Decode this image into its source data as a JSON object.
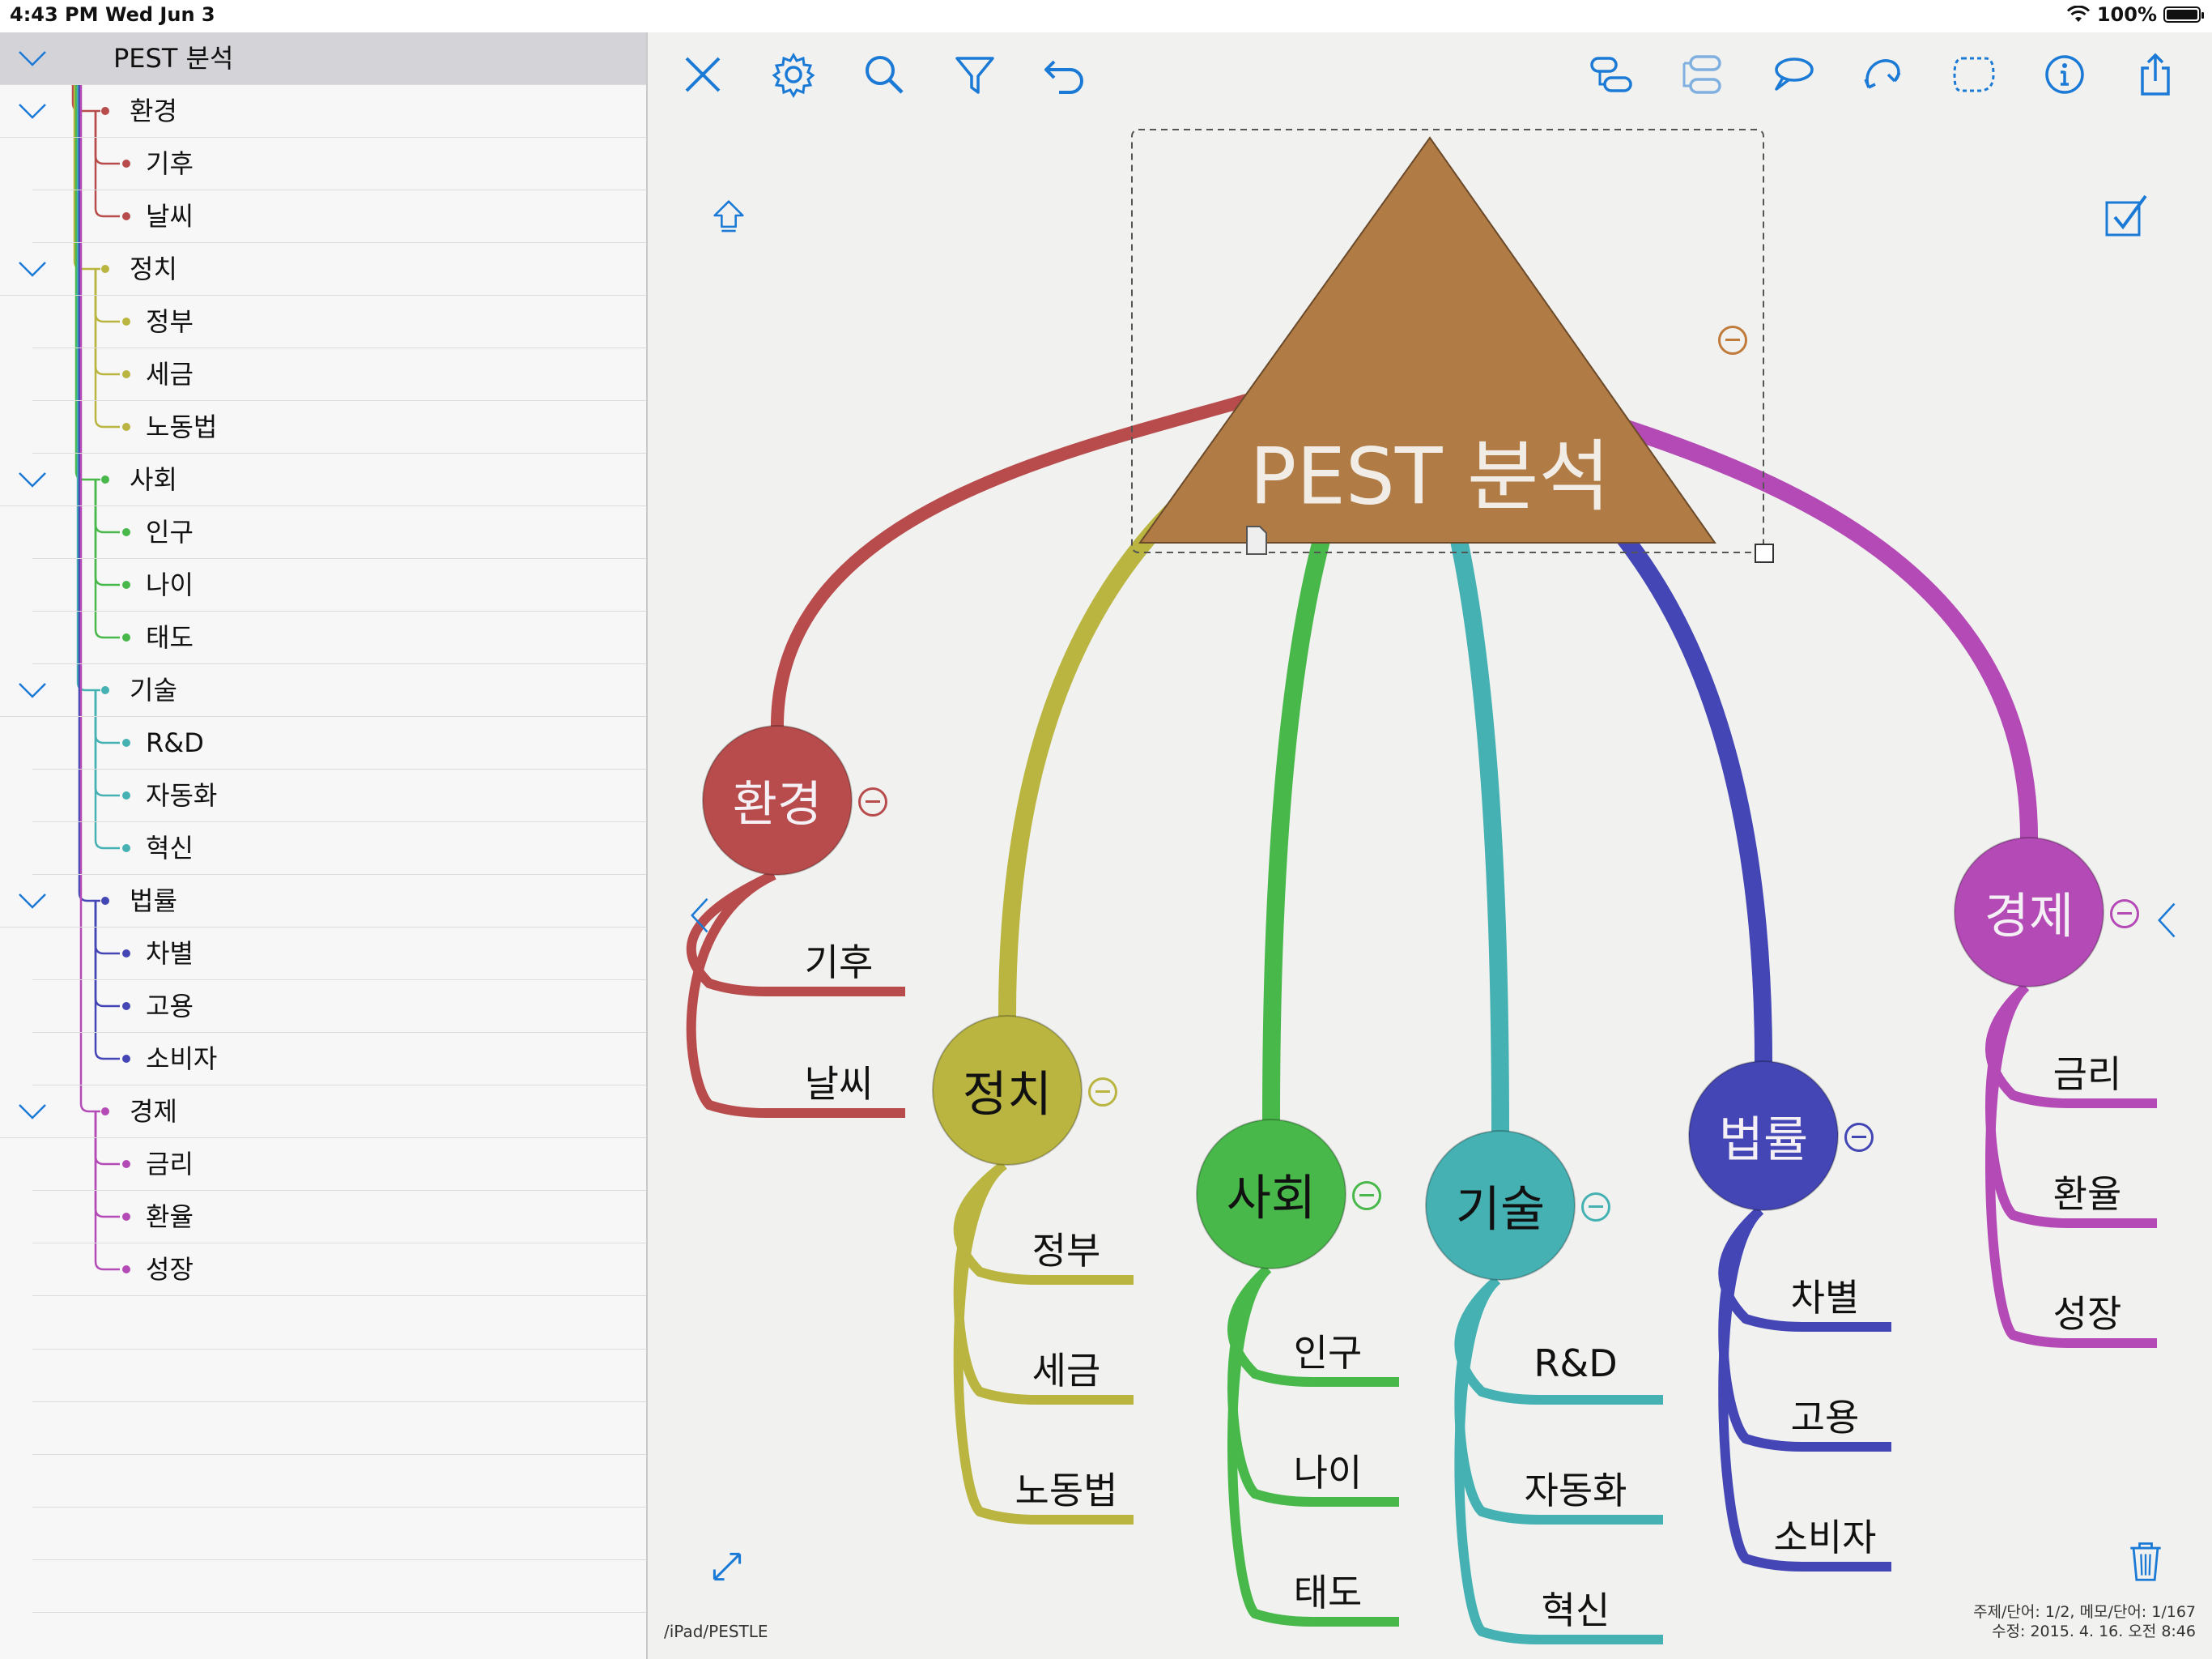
{
  "status_bar": {
    "time": "4:43 PM",
    "date": "Wed Jun 3",
    "battery": "100%"
  },
  "outline": {
    "items": [
      {
        "label": "PEST 분석",
        "level": 0,
        "color": "#b84c4c",
        "selected": true
      },
      {
        "label": "환경",
        "level": 1,
        "color": "#b84c4c"
      },
      {
        "label": "기후",
        "level": 2,
        "color": "#b84c4c"
      },
      {
        "label": "날씨",
        "level": 2,
        "color": "#b84c4c"
      },
      {
        "label": "정치",
        "level": 1,
        "color": "#b9b540"
      },
      {
        "label": "정부",
        "level": 2,
        "color": "#b9b540"
      },
      {
        "label": "세금",
        "level": 2,
        "color": "#b9b540"
      },
      {
        "label": "노동법",
        "level": 2,
        "color": "#b9b540"
      },
      {
        "label": "사회",
        "level": 1,
        "color": "#48b84a"
      },
      {
        "label": "인구",
        "level": 2,
        "color": "#48b84a"
      },
      {
        "label": "나이",
        "level": 2,
        "color": "#48b84a"
      },
      {
        "label": "태도",
        "level": 2,
        "color": "#48b84a"
      },
      {
        "label": "기술",
        "level": 1,
        "color": "#45b1b2"
      },
      {
        "label": "R&D",
        "level": 2,
        "color": "#45b1b2"
      },
      {
        "label": "자동화",
        "level": 2,
        "color": "#45b1b2"
      },
      {
        "label": "혁신",
        "level": 2,
        "color": "#45b1b2"
      },
      {
        "label": "법률",
        "level": 1,
        "color": "#4346b4"
      },
      {
        "label": "차별",
        "level": 2,
        "color": "#4346b4"
      },
      {
        "label": "고용",
        "level": 2,
        "color": "#4346b4"
      },
      {
        "label": "소비자",
        "level": 2,
        "color": "#4346b4"
      },
      {
        "label": "경제",
        "level": 1,
        "color": "#b44ab6"
      },
      {
        "label": "금리",
        "level": 2,
        "color": "#b44ab6"
      },
      {
        "label": "환율",
        "level": 2,
        "color": "#b44ab6"
      },
      {
        "label": "성장",
        "level": 2,
        "color": "#b44ab6"
      }
    ]
  },
  "toolbar": {
    "left": [
      "close-icon",
      "settings-icon",
      "search-icon",
      "filter-icon",
      "undo-icon"
    ],
    "right": [
      "add-child-topic-icon",
      "add-sibling-topic-icon",
      "callout-icon",
      "relationship-icon",
      "boundary-icon",
      "info-icon",
      "share-icon"
    ],
    "accent": "#1b7ad6"
  },
  "map": {
    "root": {
      "label": "PEST 분석",
      "color": "#b07b45"
    },
    "topics": [
      {
        "label": "환경",
        "color": "#b84c4c",
        "children": [
          "기후",
          "날씨"
        ]
      },
      {
        "label": "정치",
        "color": "#b9b540",
        "children": [
          "정부",
          "세금",
          "노동법"
        ]
      },
      {
        "label": "사회",
        "color": "#48b84a",
        "children": [
          "인구",
          "나이",
          "태도"
        ]
      },
      {
        "label": "기술",
        "color": "#45b1b2",
        "children": [
          "R&D",
          "자동화",
          "혁신"
        ]
      },
      {
        "label": "법률",
        "color": "#4346b4",
        "children": [
          "차별",
          "고용",
          "소비자"
        ]
      },
      {
        "label": "경제",
        "color": "#b44ab6",
        "children": [
          "금리",
          "환율",
          "성장"
        ]
      }
    ],
    "file_path": "/iPad/PESTLE",
    "stats_line1": "주제/단어: 1/2, 메모/단어: 1/167",
    "stats_line2": "수정: 2015. 4. 16. 오전 8:46"
  }
}
